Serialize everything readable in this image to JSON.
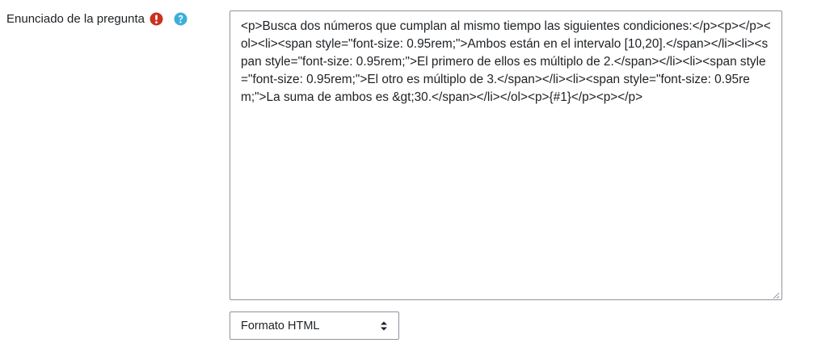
{
  "field": {
    "label": "Enunciado de la pregunta",
    "required_icon": "exclamation-circle-icon",
    "help_icon": "question-circle-icon",
    "required_color": "#ca3120",
    "help_color": "#3bafda"
  },
  "editor": {
    "value": "<p>Busca dos números que cumplan al mismo tiempo las siguientes condiciones:</p><p></p><ol><li><span style=\"font-size: 0.95rem;\">Ambos están en el intervalo [10,20].</span></li><li><span style=\"font-size: 0.95rem;\">El primero de ellos es múltiplo de 2.</span></li><li><span style=\"font-size: 0.95rem;\">El otro es múltiplo de 3.</span></li><li><span style=\"font-size: 0.95rem;\">La suma de ambos es &gt;30.</span></li></ol><p>{#1}</p><p></p>",
    "resize_icon": "resize-grip-icon"
  },
  "format": {
    "selected": "Formato HTML",
    "caret_icon": "sort-caret-icon"
  }
}
